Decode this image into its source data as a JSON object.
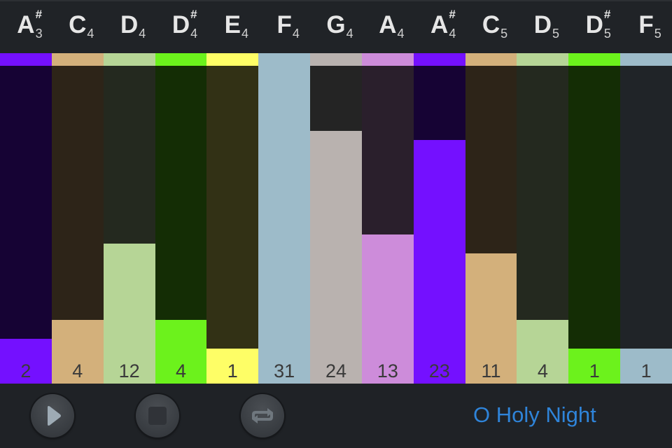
{
  "colors": {
    "header_bg": "#202327",
    "song_title": "#2f84d9",
    "count_text": "#3a3a3a"
  },
  "notes": [
    {
      "letter": "A",
      "sharp": "#",
      "octave": "3",
      "count": "2",
      "fill": 0.14,
      "color": "#7410ff",
      "track": "#160334"
    },
    {
      "letter": "C",
      "sharp": "",
      "octave": "4",
      "count": "4",
      "fill": 0.2,
      "color": "#d3b07b",
      "track": "#2d2418"
    },
    {
      "letter": "D",
      "sharp": "",
      "octave": "4",
      "count": "12",
      "fill": 0.44,
      "color": "#b6d596",
      "track": "#24291f"
    },
    {
      "letter": "D",
      "sharp": "#",
      "octave": "4",
      "count": "4",
      "fill": 0.2,
      "color": "#6cf21c",
      "track": "#142d05"
    },
    {
      "letter": "E",
      "sharp": "",
      "octave": "4",
      "count": "1",
      "fill": 0.11,
      "color": "#fefe66",
      "track": "#323115"
    },
    {
      "letter": "F",
      "sharp": "",
      "octave": "4",
      "count": "31",
      "fill": 1.0,
      "color": "#9dbbc9",
      "track": "#202428"
    },
    {
      "letter": "G",
      "sharp": "",
      "octave": "4",
      "count": "24",
      "fill": 0.795,
      "color": "#b9b2af",
      "track": "#242424"
    },
    {
      "letter": "A",
      "sharp": "",
      "octave": "4",
      "count": "13",
      "fill": 0.47,
      "color": "#cd8cda",
      "track": "#2a1f2c"
    },
    {
      "letter": "A",
      "sharp": "#",
      "octave": "4",
      "count": "23",
      "fill": 0.767,
      "color": "#7410ff",
      "track": "#160334"
    },
    {
      "letter": "C",
      "sharp": "",
      "octave": "5",
      "count": "11",
      "fill": 0.41,
      "color": "#d3b07b",
      "track": "#2d2418"
    },
    {
      "letter": "D",
      "sharp": "",
      "octave": "5",
      "count": "4",
      "fill": 0.2,
      "color": "#b6d596",
      "track": "#24291f"
    },
    {
      "letter": "D",
      "sharp": "#",
      "octave": "5",
      "count": "1",
      "fill": 0.11,
      "color": "#6cf21c",
      "track": "#142d05"
    },
    {
      "letter": "F",
      "sharp": "",
      "octave": "5",
      "count": "1",
      "fill": 0.11,
      "color": "#9dbbc9",
      "track": "#202428"
    }
  ],
  "controls": {
    "play_icon": "play-icon",
    "stop_icon": "stop-icon",
    "repeat_icon": "repeat-icon",
    "song_title": "O Holy Night"
  },
  "chart_data": {
    "type": "bar",
    "title": "",
    "categories": [
      "A#3",
      "C4",
      "D4",
      "D#4",
      "E4",
      "F4",
      "G4",
      "A4",
      "A#4",
      "C5",
      "D5",
      "D#5",
      "F5"
    ],
    "values": [
      2,
      4,
      12,
      4,
      1,
      31,
      24,
      13,
      23,
      11,
      4,
      1,
      1
    ],
    "xlabel": "",
    "ylabel": "",
    "ylim": [
      0,
      31
    ],
    "grid": false,
    "legend": "none"
  }
}
